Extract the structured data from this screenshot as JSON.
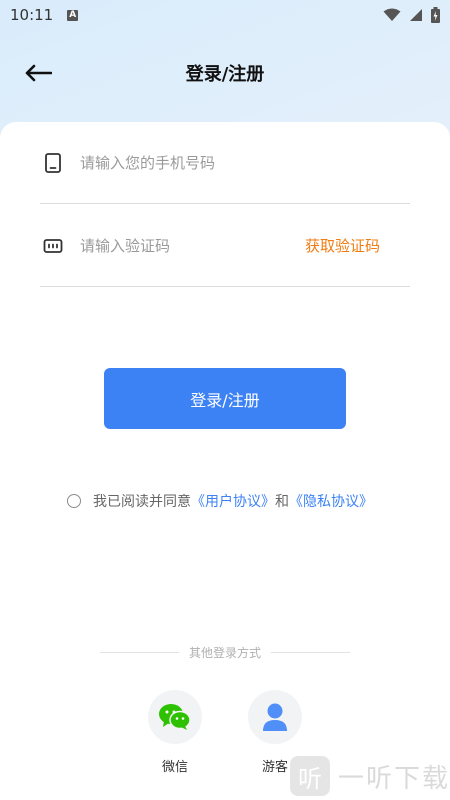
{
  "status_bar": {
    "time": "10:11",
    "input_indicator": "A"
  },
  "header": {
    "title": "登录/注册"
  },
  "form": {
    "phone": {
      "placeholder": "请输入您的手机号码",
      "value": ""
    },
    "code": {
      "placeholder": "请输入验证码",
      "value": "",
      "get_code_label": "获取验证码"
    },
    "submit_label": "登录/注册"
  },
  "agreement": {
    "prefix": "我已阅读并同意",
    "user_agreement": "《用户协议》",
    "conjunction": "和",
    "privacy_policy": "《隐私协议》"
  },
  "other_login": {
    "title": "其他登录方式",
    "options": [
      {
        "label": "微信",
        "icon": "wechat-icon",
        "color": "#2dc100"
      },
      {
        "label": "游客",
        "icon": "guest-user-icon",
        "color": "#4f8ff7"
      }
    ]
  },
  "watermark": {
    "glyph": "听",
    "text": "一听下载"
  },
  "colors": {
    "primary": "#3c82f5",
    "accent": "#ef7d12"
  }
}
